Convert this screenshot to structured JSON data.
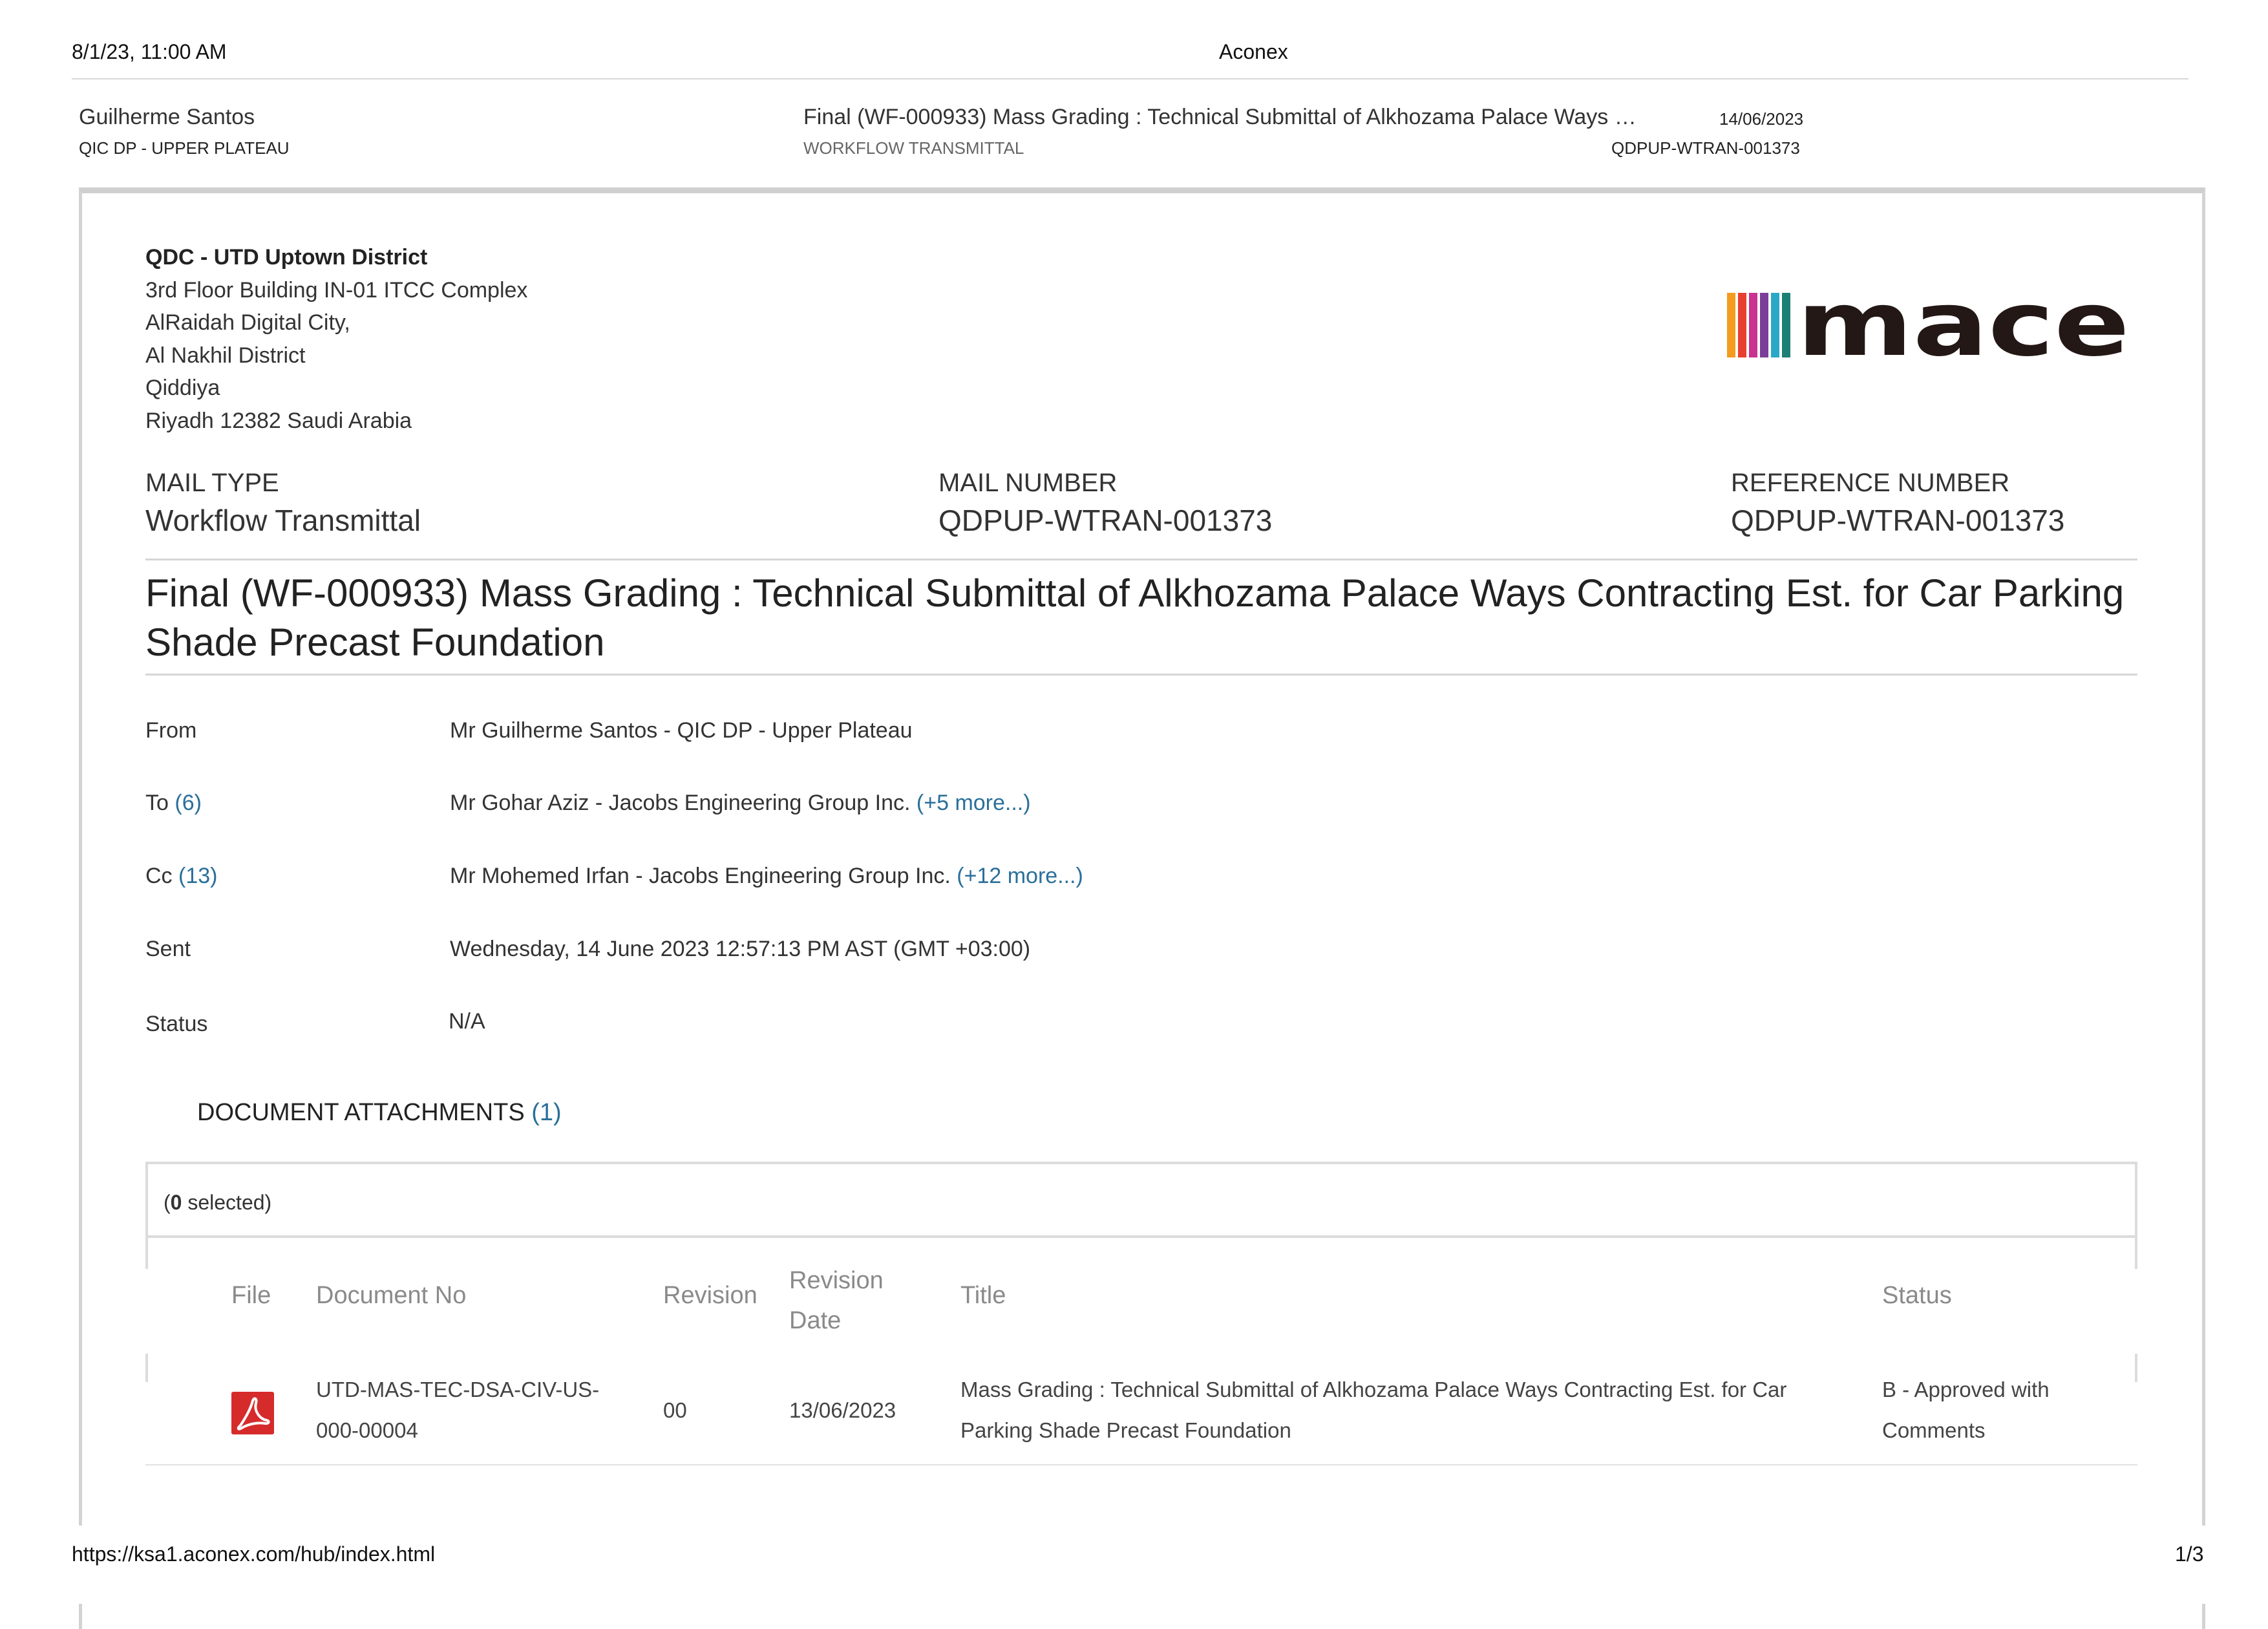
{
  "print": {
    "date": "8/1/23, 11:00 AM",
    "title": "Aconex",
    "url": "https://ksa1.aconex.com/hub/index.html",
    "page": "1/3"
  },
  "header": {
    "user": "Guilherme Santos",
    "org": "QIC DP - UPPER PLATEAU",
    "subject": "Final (WF-000933) Mass Grading : Technical Submittal of Alkhozama Palace Ways …",
    "type": "WORKFLOW TRANSMITTAL",
    "date": "14/06/2023",
    "ref": "QDPUP-WTRAN-001373"
  },
  "address": {
    "company": "QDC - UTD Uptown District",
    "lines": [
      "3rd Floor Building IN-01 ITCC Complex",
      "AlRaidah Digital City,",
      "Al Nakhil District",
      "Qiddiya",
      "Riyadh 12382 Saudi Arabia"
    ]
  },
  "logo": {
    "text": "mace",
    "stripe_colors": [
      "#f39c1f",
      "#e8402f",
      "#c8338f",
      "#7a3f98",
      "#2aa8c7",
      "#1b7f74"
    ],
    "text_color": "#231815"
  },
  "mail": {
    "type_label": "MAIL TYPE",
    "type_value": "Workflow Transmittal",
    "number_label": "MAIL NUMBER",
    "number_value": "QDPUP-WTRAN-001373",
    "reference_label": "REFERENCE NUMBER",
    "reference_value": "QDPUP-WTRAN-001373"
  },
  "subject": "Final (WF-000933) Mass Grading : Technical Submittal of Alkhozama Palace Ways Contracting Est. for Car Parking Shade Precast Foundation",
  "fields": {
    "from_label": "From",
    "from_value": "Mr Guilherme Santos - QIC DP - Upper Plateau",
    "to_label": "To",
    "to_count": "(6)",
    "to_value": "Mr Gohar Aziz - Jacobs Engineering Group Inc.",
    "to_more": "(+5 more...)",
    "cc_label": "Cc",
    "cc_count": "(13)",
    "cc_value": "Mr Mohemed Irfan - Jacobs Engineering Group Inc.",
    "cc_more": "(+12 more...)",
    "sent_label": "Sent",
    "sent_value": "Wednesday, 14 June 2023 12:57:13 PM AST (GMT +03:00)",
    "status_label": "Status",
    "status_value": "N/A"
  },
  "attachments": {
    "heading": "DOCUMENT ATTACHMENTS",
    "count": "(1)",
    "selected_prefix": "(",
    "selected_count": "0",
    "selected_suffix": " selected)",
    "columns": {
      "file": "File",
      "document_no": "Document No",
      "revision": "Revision",
      "revision_date_1": "Revision",
      "revision_date_2": "Date",
      "title": "Title",
      "status": "Status"
    },
    "rows": [
      {
        "file_icon": "pdf-icon",
        "document_no_1": "UTD-MAS-TEC-DSA-CIV-US-",
        "document_no_2": "000-00004",
        "revision": "00",
        "revision_date": "13/06/2023",
        "title_1": "Mass Grading : Technical Submittal of Alkhozama Palace Ways Contracting Est. for Car",
        "title_2": "Parking Shade Precast Foundation",
        "status_1": "B - Approved with",
        "status_2": "Comments"
      }
    ]
  }
}
